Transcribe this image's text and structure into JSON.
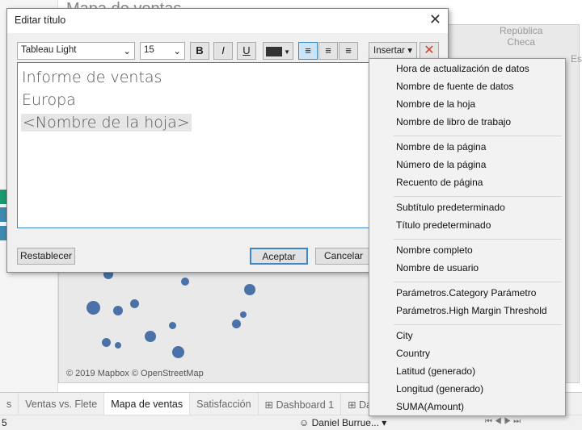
{
  "background": {
    "sheet_title": "Mapa de ventas",
    "map_labels": [
      "República",
      "Checa",
      "Es"
    ],
    "attribution": "© 2019 Mapbox © OpenStreetMap",
    "tabs": [
      "s",
      "Ventas vs. Flete",
      "Mapa de ventas",
      "Satisfacción",
      "Dashboard 1",
      "Das"
    ],
    "active_tab": "Mapa de ventas",
    "status": {
      "left": "5",
      "user": "Daniel Burrue..."
    }
  },
  "dialog": {
    "title": "Editar título",
    "font": "Tableau Light",
    "size": "15",
    "bold": "B",
    "italic": "I",
    "underline": "U",
    "insert_label": "Insertar",
    "color": "#333333",
    "accent": "#3c87c6",
    "lines": [
      "Informe de ventas",
      "Europa",
      "<Nombre de la hoja>"
    ],
    "reset": "Restablecer",
    "ok": "Aceptar",
    "cancel": "Cancelar"
  },
  "menu": {
    "groups": [
      [
        "Hora de actualización de datos",
        "Nombre de fuente de datos",
        "Nombre de la hoja",
        "Nombre de libro de trabajo"
      ],
      [
        "Nombre de la página",
        "Número de la página",
        "Recuento de página"
      ],
      [
        "Subtítulo predeterminado",
        "Título predeterminado"
      ],
      [
        "Nombre completo",
        "Nombre de usuario"
      ],
      [
        "Parámetros.Category Parámetro",
        "Parámetros.High Margin Threshold"
      ],
      [
        "City",
        "Country",
        "Latitud (generado)",
        "Longitud (generado)",
        "SUMA(Amount)"
      ]
    ]
  }
}
